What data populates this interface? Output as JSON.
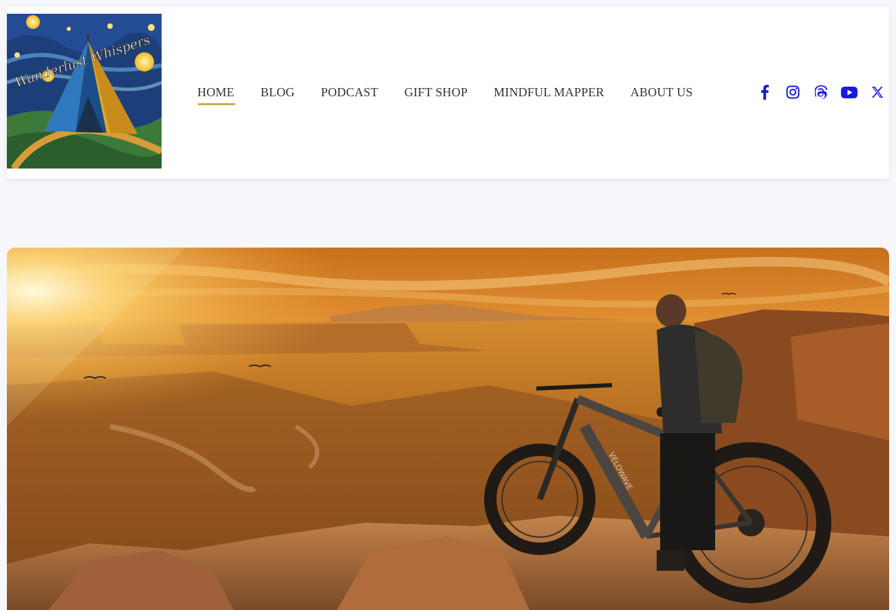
{
  "site": {
    "logo_text": "Wanderlust Whispers"
  },
  "nav": {
    "items": [
      {
        "label": "HOME",
        "active": true
      },
      {
        "label": "BLOG",
        "active": false
      },
      {
        "label": "PODCAST",
        "active": false
      },
      {
        "label": "GIFT SHOP",
        "active": false
      },
      {
        "label": "MINDFUL MAPPER",
        "active": false
      },
      {
        "label": "ABOUT US",
        "active": false
      }
    ]
  },
  "social": {
    "color": "#1a1adb",
    "icons": [
      "facebook-icon",
      "instagram-icon",
      "threads-icon",
      "youtube-icon",
      "x-icon"
    ]
  },
  "hero": {
    "bike_brand": "VELOWAVE"
  },
  "colors": {
    "accent": "#c9a94b",
    "background": "#f6f7fa",
    "nav_text": "#333333"
  }
}
